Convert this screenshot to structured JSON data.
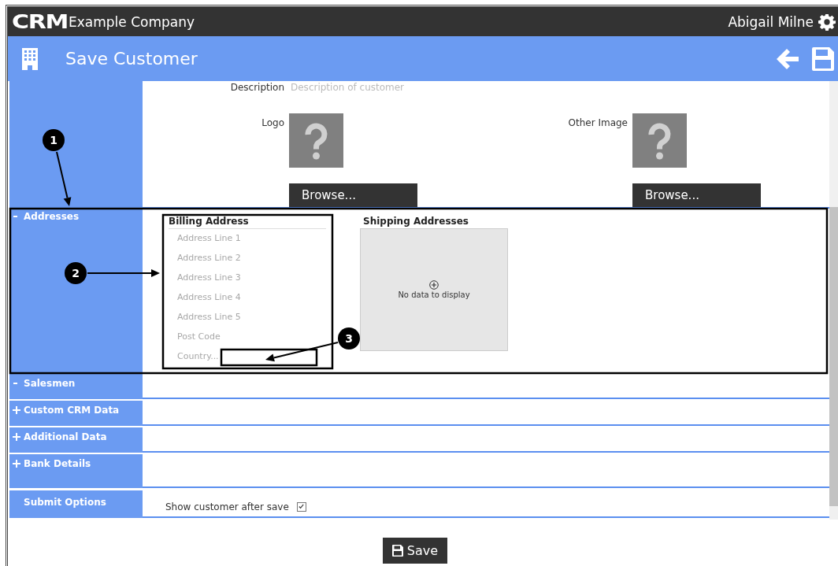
{
  "header": {
    "logo": "CRM",
    "company": "Example Company",
    "user": "Abigail Milne"
  },
  "page": {
    "title": "Save Customer"
  },
  "general": {
    "description": {
      "label": "Description",
      "placeholder": "Description of customer"
    },
    "images": [
      {
        "label": "Logo",
        "button": "Browse..."
      },
      {
        "label": "Other Image",
        "button": "Browse..."
      }
    ]
  },
  "sections": [
    {
      "title": "Addresses",
      "expanded": true,
      "kind": "addresses"
    },
    {
      "title": "Salesmen",
      "expanded": true,
      "kind": "empty"
    },
    {
      "title": "Custom CRM Data",
      "expanded": false,
      "kind": "empty"
    },
    {
      "title": "Additional Data",
      "expanded": false,
      "kind": "empty"
    },
    {
      "title": "Bank Details",
      "expanded": false,
      "kind": "tall"
    }
  ],
  "addresses": {
    "billing": {
      "title": "Billing Address",
      "fields": [
        {
          "placeholder": "Address Line 1"
        },
        {
          "placeholder": "Address Line 2"
        },
        {
          "placeholder": "Address Line 3"
        },
        {
          "placeholder": "Address Line 4"
        },
        {
          "placeholder": "Address Line 5"
        },
        {
          "placeholder": "Post Code"
        }
      ],
      "country": {
        "placeholder": "Country..."
      }
    },
    "shipping": {
      "title": "Shipping Addresses",
      "empty_text": "No data to display"
    }
  },
  "submit_options": {
    "title": "Submit Options",
    "option": {
      "label": "Show customer after save",
      "checked": true
    }
  },
  "save_button": "Save",
  "annotations": [
    {
      "number": "1"
    },
    {
      "number": "2"
    },
    {
      "number": "3"
    }
  ]
}
